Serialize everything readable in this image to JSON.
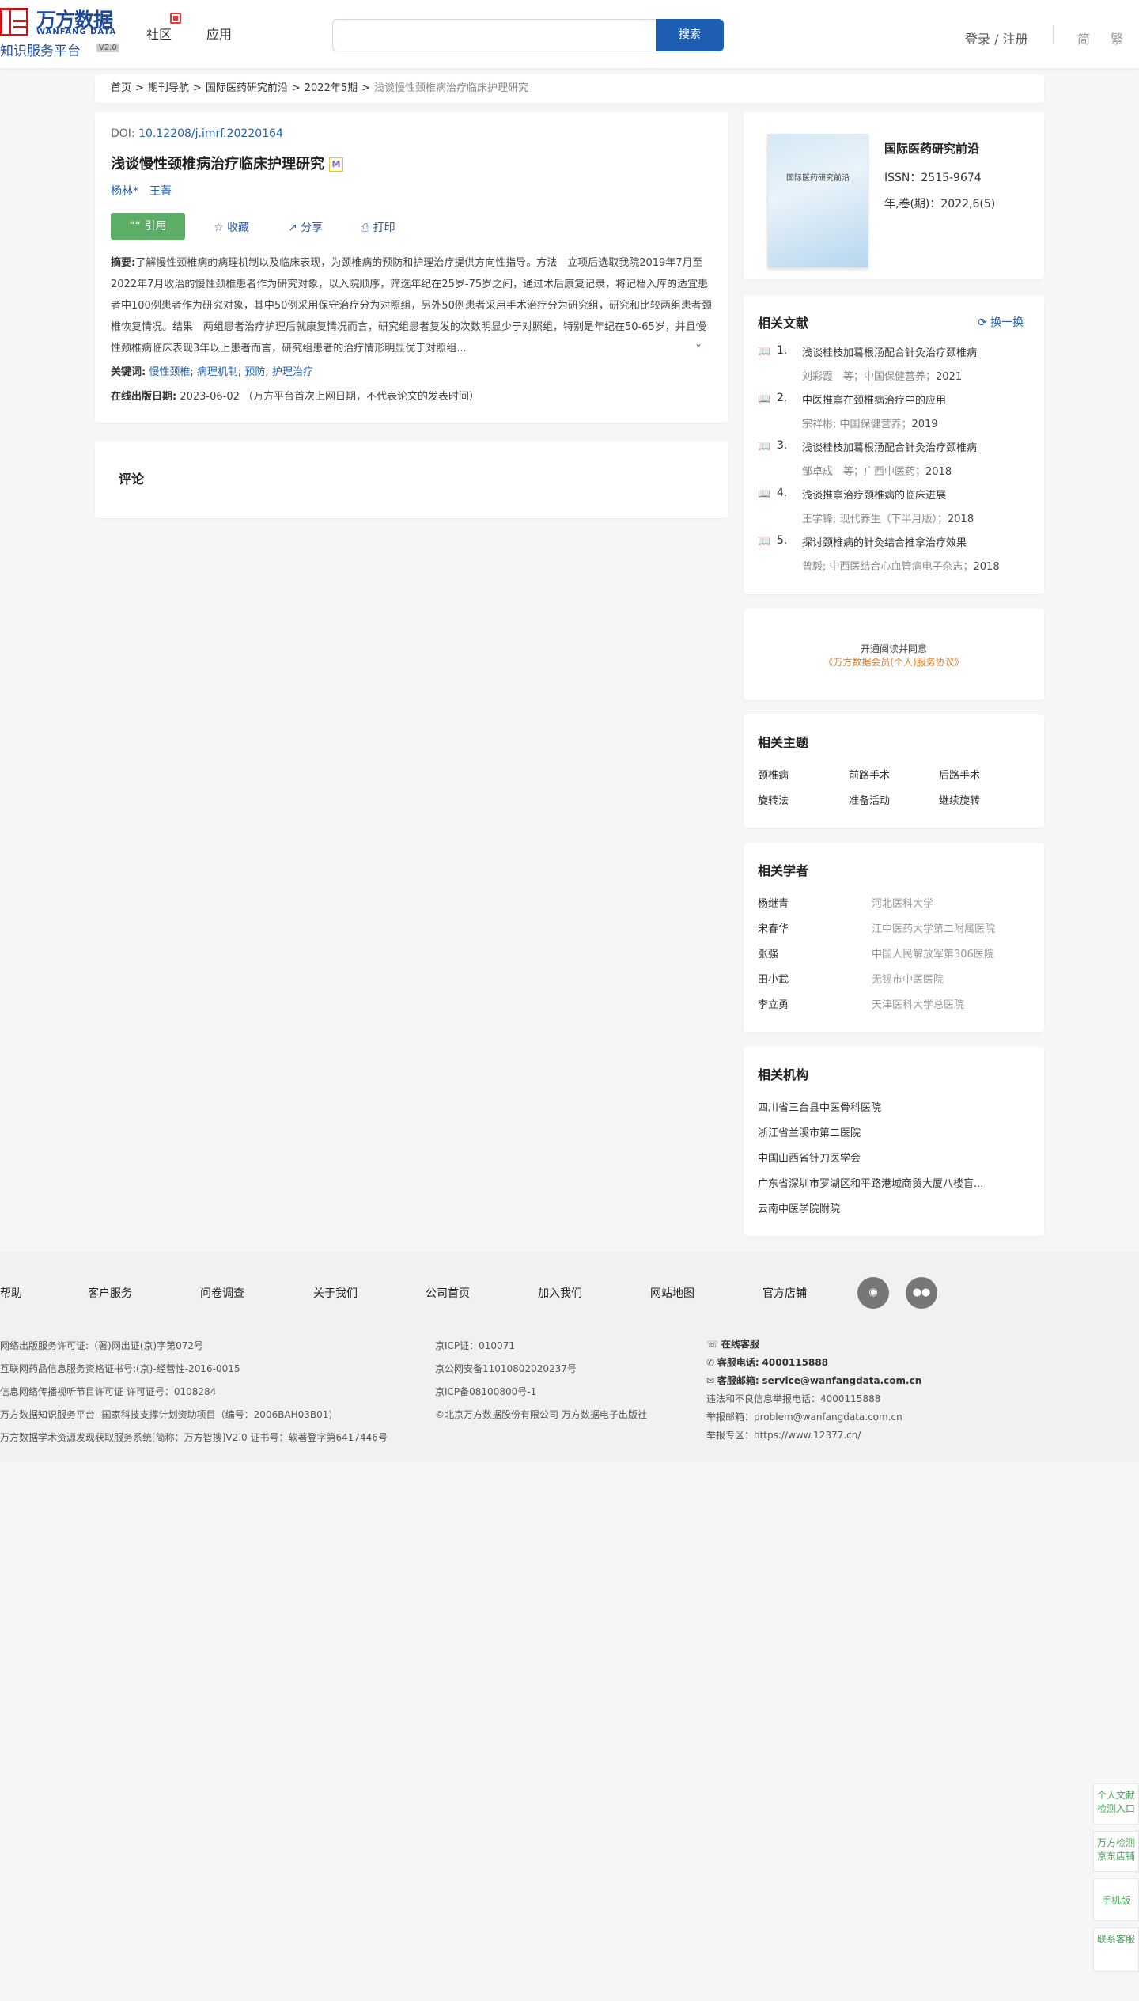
{
  "header": {
    "logo_cn": "万方数据",
    "logo_en": "WANFANG DATA",
    "logo_sub": "知识服务平台",
    "logo_version": "V2.0",
    "nav": [
      "社区",
      "应用"
    ],
    "search_placeholder": "",
    "search_button": "搜索",
    "login": "登录 / 注册",
    "lang_simplified": "简",
    "lang_traditional": "繁"
  },
  "breadcrumb": [
    "首页",
    "期刊导航",
    "国际医药研究前沿",
    "2022年5期",
    "浅谈慢性颈椎病治疗临床护理研究"
  ],
  "article": {
    "doi_label": "DOI:",
    "doi": "10.12208/j.imrf.20220164",
    "title": "浅谈慢性颈椎病治疗临床护理研究",
    "title_badge": "M",
    "authors": [
      "杨林*",
      "王菁"
    ],
    "actions": {
      "cite": "引用",
      "collect": "收藏",
      "share": "分享",
      "print": "打印"
    },
    "abstract_label": "摘要:",
    "abstract": "了解慢性颈椎病的病理机制以及临床表现，为颈椎病的预防和护理治疗提供方向性指导。方法　立项后选取我院2019年7月至2022年7月收治的慢性颈椎患者作为研究对象，以入院顺序，筛选年纪在25岁-75岁之间，通过术后康复记录，将记档入库的适宜患者中100例患者作为研究对象，其中50例采用保守治疗分为对照组，另外50例患者采用手术治疗分为研究组，研究和比较两组患者颈椎恢复情况。结果　两组患者治疗护理后就康复情况而言，研究组患者复发的次数明显少于对照组，特别是年纪在50-65岁，并且慢性颈椎病临床表现3年以上患者而言，研究组患者的治疗情形明显优于对照组...",
    "keywords_label": "关键词:",
    "keywords": [
      "慢性颈椎",
      "病理机制",
      "预防",
      "护理治疗"
    ],
    "pubdate_label": "在线出版日期:",
    "pubdate": "2023-06-02",
    "pubdate_note": "（万方平台首次上网日期，不代表论文的发表时间）"
  },
  "comment": {
    "title": "评论"
  },
  "journal": {
    "cover_text": "国际医药研究前沿",
    "name": "国际医药研究前沿",
    "issn": "ISSN：2515-9674",
    "volume": "年,卷(期)：2022,6(5)"
  },
  "related_docs": {
    "title": "相关文献",
    "refresh": "换一换",
    "items": [
      {
        "num": "1.",
        "title": "浅谈桂枝加葛根汤配合针灸治疗颈椎病",
        "meta": "刘彩霞　等；中国保健营养；",
        "year": "2021"
      },
      {
        "num": "2.",
        "title": "中医推拿在颈椎病治疗中的应用",
        "meta": "宗祥彬; 中国保健营养；",
        "year": "2019"
      },
      {
        "num": "3.",
        "title": "浅谈桂枝加葛根汤配合针灸治疗颈椎病",
        "meta": "邹卓成　等；广西中医药；",
        "year": "2018"
      },
      {
        "num": "4.",
        "title": "浅谈推拿治疗颈椎病的临床进展",
        "meta": "王学锋; 现代养生（下半月版）；",
        "year": "2018"
      },
      {
        "num": "5.",
        "title": "探讨颈椎病的针灸结合推拿治疗效果",
        "meta": "曾毅; 中西医结合心血管病电子杂志；",
        "year": "2018"
      }
    ]
  },
  "agreement": {
    "line1": "开通阅读并同意",
    "line2": "《万方数据会员(个人)服务协议》"
  },
  "topics": {
    "title": "相关主题",
    "items": [
      "颈椎病",
      "前路手术",
      "后路手术",
      "旋转法",
      "准备活动",
      "继续旋转"
    ]
  },
  "scholars": {
    "title": "相关学者",
    "items": [
      {
        "name": "杨继青",
        "inst": "河北医科大学"
      },
      {
        "name": "宋春华",
        "inst": "江中医药大学第二附属医院"
      },
      {
        "name": "张强",
        "inst": "中国人民解放军第306医院"
      },
      {
        "name": "田小武",
        "inst": "无锡市中医医院"
      },
      {
        "name": "李立勇",
        "inst": "天津医科大学总医院"
      }
    ]
  },
  "orgs": {
    "title": "相关机构",
    "items": [
      "四川省三台县中医骨科医院",
      "浙江省兰溪市第二医院",
      "中国山西省针刀医学会",
      "广东省深圳市罗湖区和平路港城商贸大厦八楼盲...",
      "云南中医学院附院"
    ]
  },
  "footer": {
    "nav": [
      "帮助",
      "客户服务",
      "问卷调查",
      "关于我们",
      "公司首页",
      "加入我们",
      "网站地图",
      "官方店铺"
    ],
    "col1": [
      "网络出版服务许可证:（署)网出证(京)字第072号",
      "互联网药品信息服务资格证书号:(京)-经营性-2016-0015",
      "信息网络传播视听节目许可证 许可证号：0108284",
      "万方数据知识服务平台--国家科技支撑计划资助项目（编号：2006BAH03B01)",
      "万方数据学术资源发现获取服务系统[简称：万方智搜]V2.0 证书号：软著登字第6417446号"
    ],
    "col2": [
      "京ICP证：010071",
      "京公网安备11010802020237号",
      "京ICP备08100800号-1",
      "©北京万方数据股份有限公司 万方数据电子出版社"
    ],
    "online_service": "在线客服",
    "phone_label": "客服电话:",
    "phone": "4000115888",
    "email_label": "客服邮箱:",
    "email": "service@wanfangdata.com.cn",
    "report_phone": "违法和不良信息举报电话：4000115888",
    "report_email": "举报邮箱：problem@wanfangdata.com.cn",
    "report_site": "举报专区：https://www.12377.cn/"
  },
  "floating": [
    "个人文献检测入口",
    "万方检测京东店铺",
    "手机版",
    "联系客服"
  ]
}
